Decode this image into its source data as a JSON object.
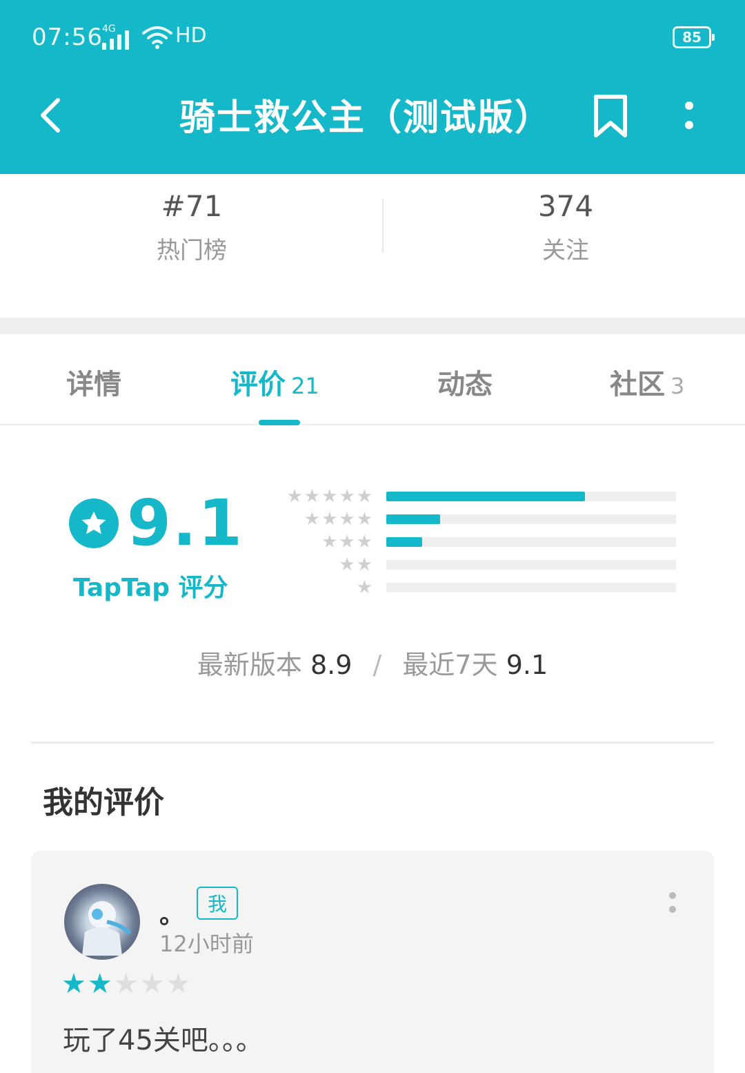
{
  "status_bar": {
    "time": "07:56",
    "network": "4G",
    "hd": "HD",
    "battery": "85"
  },
  "header": {
    "title": "骑士救公主（测试版）",
    "back_icon": "chevron-left-icon",
    "bookmark_icon": "bookmark-icon",
    "more_icon": "more-vertical-icon"
  },
  "stats": {
    "rank_value": "#71",
    "rank_label": "热门榜",
    "follow_value": "374",
    "follow_label": "关注"
  },
  "tabs": [
    {
      "label": "详情",
      "count": ""
    },
    {
      "label": "评价",
      "count": "21",
      "active": true
    },
    {
      "label": "动态",
      "count": ""
    },
    {
      "label": "社区",
      "count": "3"
    }
  ],
  "rating": {
    "score": "9.1",
    "brand": "TapTap 评分",
    "distribution": [
      {
        "stars": 5,
        "fraction": 0.686
      },
      {
        "stars": 4,
        "fraction": 0.186
      },
      {
        "stars": 3,
        "fraction": 0.124
      },
      {
        "stars": 2,
        "fraction": 0.0
      },
      {
        "stars": 1,
        "fraction": 0.0
      }
    ],
    "latest_version_label": "最新版本",
    "latest_version_score": "8.9",
    "recent_label": "最近7天",
    "recent_score": "9.1",
    "separator": "/"
  },
  "my_review": {
    "section_title": "我的评价",
    "username": "。",
    "badge": "我",
    "time": "12小时前",
    "stars_filled": 2,
    "stars_total": 5,
    "text": "玩了45关吧。。。"
  },
  "colors": {
    "accent": "#15b8c8",
    "header_bg": "#15b8c8",
    "star_off": "#dedede"
  }
}
